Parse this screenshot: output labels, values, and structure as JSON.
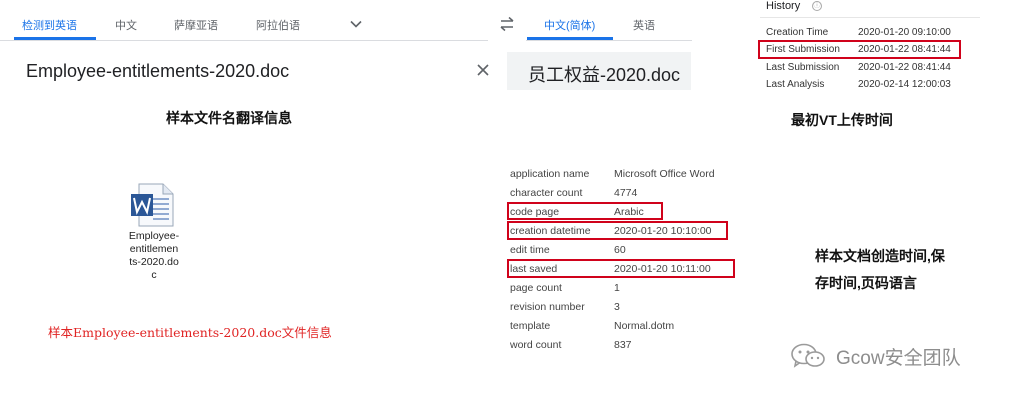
{
  "translate": {
    "source_tabs": [
      "检测到英语",
      "中文",
      "萨摩亚语",
      "阿拉伯语"
    ],
    "target_tabs": [
      "中文(简体)",
      "英语"
    ],
    "source_text": "Employee-entitlements-2020.doc",
    "target_text": "员工权益-2020.doc"
  },
  "captions": {
    "filename_translation": "样本文件名翻译信息",
    "first_vt_upload": "最初VT上传时间",
    "doc_times_line1": "样本文档创造时间,保",
    "doc_times_line2": "存时间,页码语言",
    "sample_info": "样本Employee-entitlements-2020.doc文件信息"
  },
  "history": {
    "title": "History",
    "info_icon": "ⓘ",
    "rows": [
      {
        "label": "Creation Time",
        "value": "2020-01-20 09:10:00"
      },
      {
        "label": "First Submission",
        "value": "2020-01-22 08:41:44"
      },
      {
        "label": "Last Submission",
        "value": "2020-01-22 08:41:44"
      },
      {
        "label": "Last Analysis",
        "value": "2020-02-14 12:00:03"
      }
    ]
  },
  "file": {
    "name_lines": [
      "Employee-",
      "entitlemen",
      "ts-2020.do",
      "c"
    ]
  },
  "properties": [
    {
      "label": "application name",
      "value": "Microsoft Office Word"
    },
    {
      "label": "character count",
      "value": "4774"
    },
    {
      "label": "code page",
      "value": "Arabic"
    },
    {
      "label": "creation datetime",
      "value": "2020-01-20 10:10:00"
    },
    {
      "label": "edit time",
      "value": "60"
    },
    {
      "label": "last saved",
      "value": "2020-01-20 10:11:00"
    },
    {
      "label": "page count",
      "value": "1"
    },
    {
      "label": "revision number",
      "value": "3"
    },
    {
      "label": "template",
      "value": "Normal.dotm"
    },
    {
      "label": "word count",
      "value": "837"
    }
  ],
  "watermark": "Gcow安全团队",
  "colors": {
    "accent": "#1a73e8",
    "highlight": "#d0021b",
    "caption_red": "#e02424"
  }
}
